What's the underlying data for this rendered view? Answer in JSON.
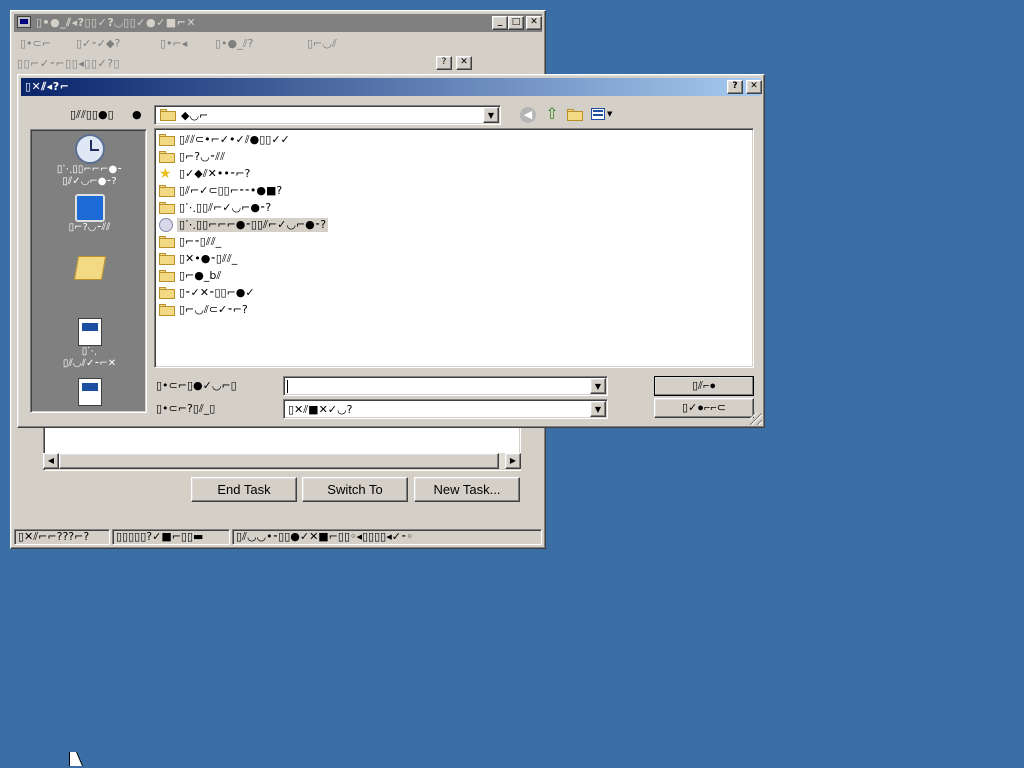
{
  "task_manager": {
    "title": "▯•●_⫽◂?▯▯✓?◡▯▯✓●✓■⌐✕",
    "min_label": "_",
    "max_label": "□",
    "close_label": "✕",
    "menu": [
      "▯•⊂⌐",
      "▯✓⁃✓◆?",
      "▯•⌐◂",
      "▯•●_⫽?",
      "▯⌐◡⫽"
    ],
    "tabs_help_label": "?",
    "tabs_close_label": "✕",
    "tab_text": "▯▯⌐✓⁃⌐▯▯◂▯▯✓?▯",
    "end_task_label": "End Task",
    "switch_to_label": "Switch To",
    "new_task_label": "New Task...",
    "status": [
      "▯✕⫽⌐⌐???⌐?",
      "▯▯▯▯▯?✓■⌐▯▯▬",
      "▯⫽◡◡•⁃▯▯●✓✕■⌐▯▯◦◂▯▯▯▯◂✓⁃◦"
    ]
  },
  "dialog": {
    "title": "▯✕⫽◂?⌐",
    "help_label": "?",
    "close_label": "✕",
    "lookin_label": "▯⫽⫽▯▯●▯",
    "lookin_value": "◆◡⌐",
    "places": [
      {
        "icon": "history-icon",
        "label1": "▯⋱▯▯⌐⌐⌐●⁃",
        "label2": "▯⫽✓◡⌐●⁃?"
      },
      {
        "icon": "desktop-icon",
        "label1": "▯⌐?◡⁃⫽⫽",
        "label2": ""
      },
      {
        "icon": "my-documents-icon",
        "label1": "",
        "label2": ""
      },
      {
        "icon": "my-computer-icon",
        "label1": "▯⋱",
        "label2": "▯⫽◡⫽✓⁃⌐✕"
      },
      {
        "icon": "network-icon",
        "label1": "",
        "label2": ""
      }
    ],
    "files": [
      {
        "icon": "folder-icon",
        "name": "▯⫽⫽⊂•⌐✓•✓⫽●▯▯✓✓"
      },
      {
        "icon": "folder-icon",
        "name": "▯⌐?◡⁃⫽⫽"
      },
      {
        "icon": "star-icon",
        "name": "▯✓◆⫽✕••⁃⌐?"
      },
      {
        "icon": "folder-icon",
        "name": "▯⫽⌐✓⊂▯▯⌐⁃⁃•●■?"
      },
      {
        "icon": "folder-icon",
        "name": "▯⋱▯▯⫽⌐✓◡⌐●⁃?"
      },
      {
        "icon": "cd-icon",
        "name": "▯⋱▯▯⌐⌐⌐●⁃▯▯⫽⌐✓◡⌐●⁃?"
      },
      {
        "icon": "folder-icon",
        "name": "▯⌐⁃▯⫽⫽_"
      },
      {
        "icon": "folder-icon",
        "name": "▯✕•●⁃▯⫽⫽_"
      },
      {
        "icon": "folder-icon",
        "name": "▯⌐●_b⫽"
      },
      {
        "icon": "folder-icon",
        "name": "▯⁃✓✕⁃▯▯⌐●✓"
      },
      {
        "icon": "folder-icon",
        "name": "▯⌐◡⫽⊂✓⁃⌐?"
      }
    ],
    "filename_label": "▯•⊂⌐▯●✓◡⌐▯",
    "filename_value": "",
    "filetype_label": "▯•⊂⌐?▯⫽_▯",
    "filetype_value": "▯✕⫽■✕✓◡?",
    "open_label": "▯⫽⌐●",
    "cancel_label": "▯✓●⌐⌐⊂"
  },
  "colors": {
    "desktop": "#3a6ea5",
    "active_title_start": "#0a246a",
    "active_title_end": "#a6caf0",
    "inactive_title": "#808080"
  }
}
